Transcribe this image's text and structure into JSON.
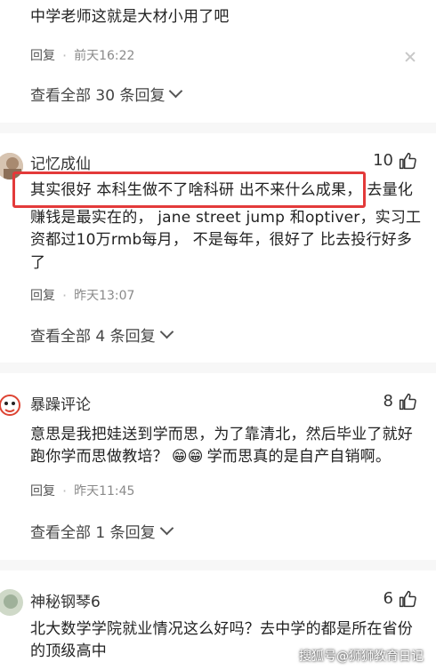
{
  "comments": [
    {
      "text": "中学老师这就是大材小用了吧",
      "reply_label": "回复",
      "time": "前天16:22",
      "view_all": "查看全部 30 条回复"
    },
    {
      "username": "记忆成仙",
      "likes": "10",
      "text_highlight": "其实很好 本科生做不了啥科研 出不来什么成果，",
      "text_line1_rest": "去量化",
      "text_line2": "赚钱是最实在的， jane street jump 和optiver，实习工",
      "text_line3": "资都过10万rmb每月， 不是每年，很好了 比去投行好多",
      "text_line4": "了",
      "reply_label": "回复",
      "time": "昨天13:07",
      "view_all": "查看全部 4 条回复"
    },
    {
      "username": "暴躁评论",
      "likes": "8",
      "text_line1": "意思是我把娃送到学而思，为了靠清北，然后毕业了就好",
      "text_line2_a": "跑你学而思做教培？",
      "emoji": "😁😁",
      "text_line2_b": "学而思真的是自产自销啊。",
      "reply_label": "回复",
      "time": "昨天11:45",
      "view_all": "查看全部 1 条回复"
    },
    {
      "username": "神秘钢琴6",
      "likes": "6",
      "text_line1": "北大数学学院就业情况这么好吗？去中学的都是所在省份",
      "text_line2": "的顶级高中"
    }
  ],
  "watermark": "搜狐号@狮狮教育日记",
  "colors": {
    "highlight": "#e33a3a",
    "text": "#222222",
    "meta": "#8a8a8a"
  }
}
